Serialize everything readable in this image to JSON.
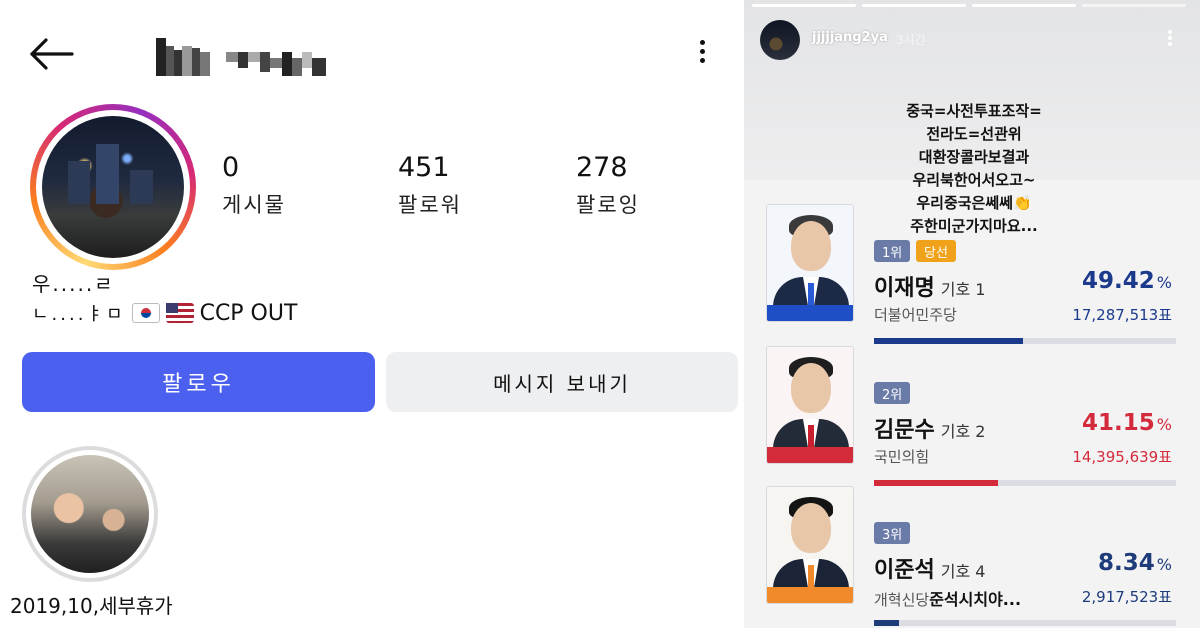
{
  "profile": {
    "stats": [
      {
        "value": "0",
        "label": "게시물"
      },
      {
        "value": "451",
        "label": "팔로워"
      },
      {
        "value": "278",
        "label": "팔로잉"
      }
    ],
    "bio_line1": "우.....ㄹ",
    "bio_line2_prefix": "ㄴ....ㅑㅁ",
    "bio_line2_suffix": "CCP OUT",
    "follow_label": "팔로우",
    "message_label": "메시지 보내기",
    "highlight_label": "2019,10,세부휴가"
  },
  "story": {
    "username": "jjjjjang2ya",
    "time": "3시간",
    "overlay_lines": [
      "중국=사전투표조작=",
      "전라도=선관위",
      "대환장콜라보결과",
      "우리북한어서오고~",
      "우리중국은쎄쎄👏",
      "주한미군가지마요..."
    ],
    "candidates": [
      {
        "rank": "1위",
        "badge": "당선",
        "name": "이재명",
        "number": "기호 1",
        "pct": "49.42",
        "pct_suffix": "%",
        "party": "더불어민주당",
        "party_extra": "",
        "votes": "17,287,513표",
        "share": 49.42,
        "color": "#1b3a8c",
        "tie": "#2a5bd7",
        "stripe": "#1f4fc7",
        "bg": "#f3f6fb"
      },
      {
        "rank": "2위",
        "badge": "",
        "name": "김문수",
        "number": "기호 2",
        "pct": "41.15",
        "pct_suffix": "%",
        "party": "국민의힘",
        "party_extra": "",
        "votes": "14,395,639표",
        "share": 41.15,
        "color": "#d32a3c",
        "tie": "#c8202f",
        "stripe": "#d42b3b",
        "bg": "#fbf4f4"
      },
      {
        "rank": "3위",
        "badge": "",
        "name": "이준석",
        "number": "기호 4",
        "pct": "8.34",
        "pct_suffix": "%",
        "party": "개혁신당",
        "party_extra": "준석시치야...",
        "votes": "2,917,523표",
        "share": 8.34,
        "color": "#1e3b7a",
        "tie": "#f08a2b",
        "stripe": "#f08a2b",
        "bg": "#f7f5f1"
      }
    ]
  },
  "colors": {
    "follow_button": "#4c60f0",
    "rank_badge": "#6a7ba8",
    "winner_badge": "#f0a21b",
    "winner_pct_suffix": "#1b3a8c"
  }
}
